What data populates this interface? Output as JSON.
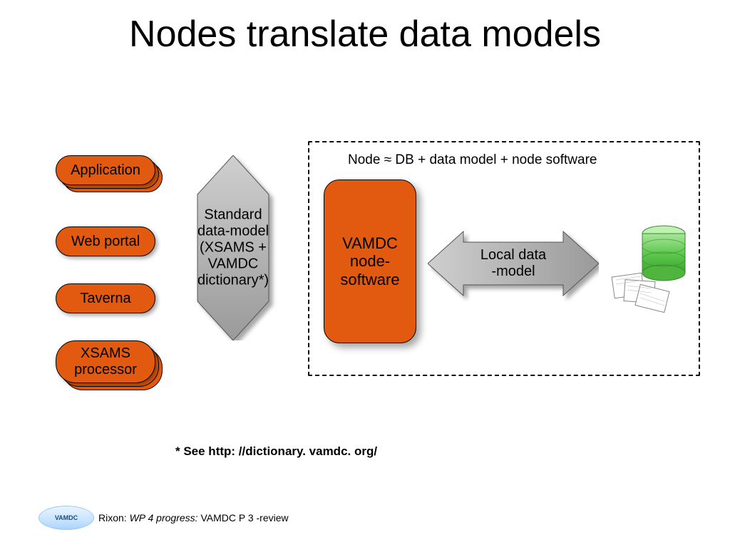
{
  "title": "Nodes translate data models",
  "pills": {
    "application": "Application",
    "webportal": "Web portal",
    "taverna": "Taverna",
    "xsams_proc_l1": "XSAMS",
    "xsams_proc_l2": "processor"
  },
  "node_caption": "Node ≈ DB + data model + node software",
  "arrow1_l1": "Standard",
  "arrow1_l2": "data-model",
  "arrow1_l3": "(XSAMS +",
  "arrow1_l4": "VAMDC",
  "arrow1_l5": "dictionary*)",
  "vamdc_l1": "VAMDC",
  "vamdc_l2": "node-",
  "vamdc_l3": "software",
  "arrow2_l1": "Local data",
  "arrow2_l2": "-model",
  "footnote": "* See http: //dictionary. vamdc. org/",
  "logo_text": "VAMDC",
  "footer_author": "Rixon:",
  "footer_italic": "WP 4 progress:",
  "footer_tail": "VAMDC P 3 -review"
}
